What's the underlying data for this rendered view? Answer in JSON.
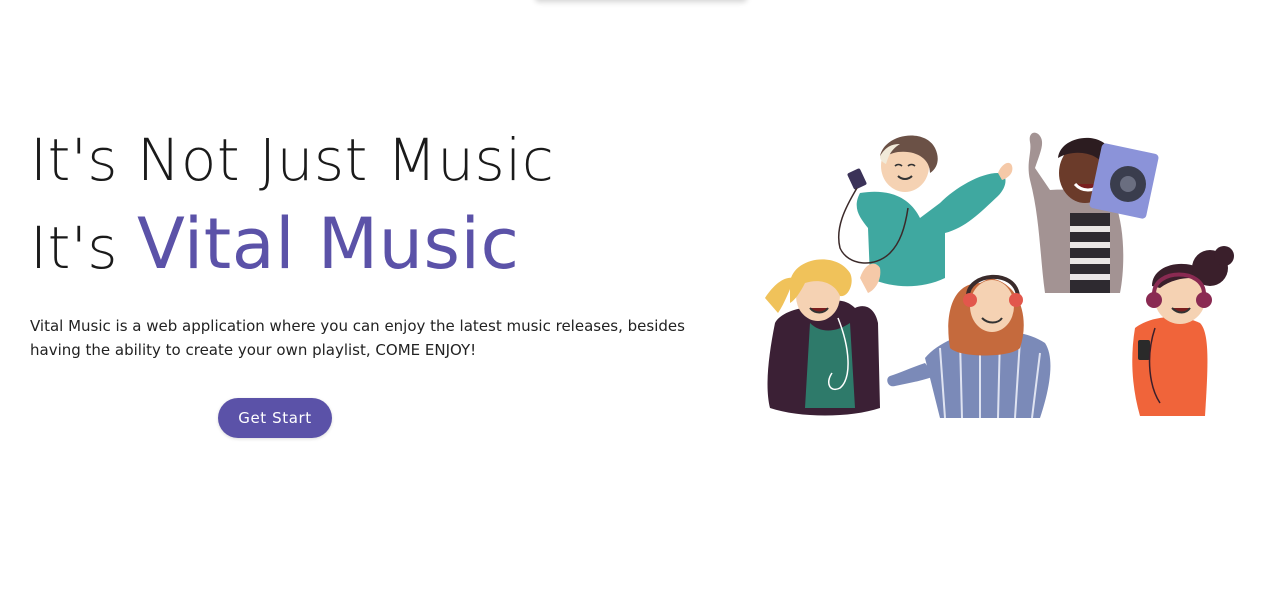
{
  "hero": {
    "headline_line1": "It's Not Just Music",
    "headline_line2_prefix": "It's",
    "headline_line2_accent": "Vital Music",
    "description_line1": "Vital Music is a web application where you can enjoy the latest music releases, besides",
    "description_line2": "having the ability to create your own playlist, COME ENJOY!",
    "cta_label": "Get Start"
  },
  "colors": {
    "accent": "#5b52a8",
    "button_bg": "#5b52a8"
  },
  "illustration": {
    "icon": "people-listening-music-illustration"
  }
}
